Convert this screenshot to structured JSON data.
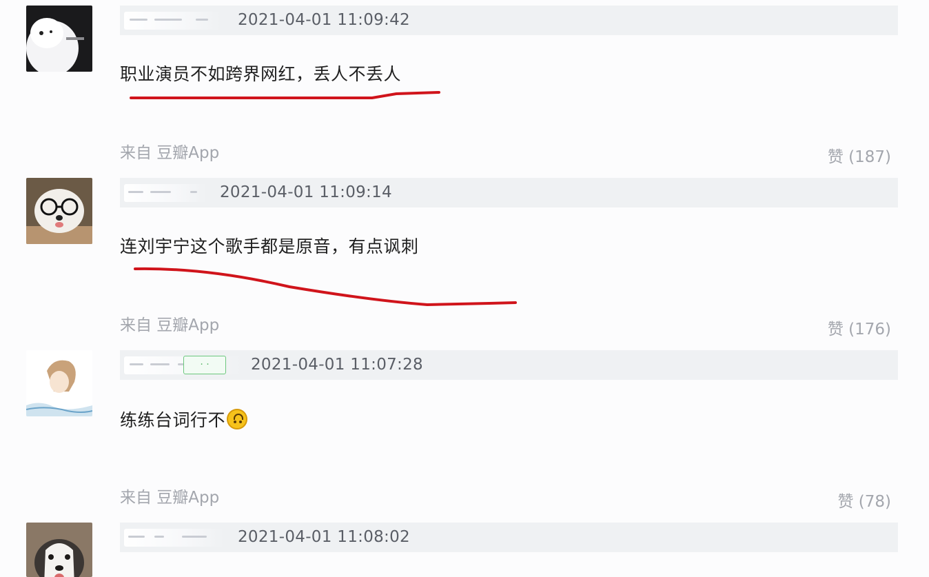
{
  "comments": [
    {
      "timestamp": "2021-04-01 11:09:42",
      "text": "职业演员不如跨界网红，丢人不丢人",
      "source": "来自 豆瓣App",
      "likes": "赞 (187)",
      "avatar_icon": "white-dog-avatar"
    },
    {
      "timestamp": "2021-04-01 11:09:14",
      "text": "连刘宇宁这个歌手都是原音，有点讽刺",
      "source": "来自 豆瓣App",
      "likes": "赞 (176)",
      "avatar_icon": "dog-with-glasses-avatar"
    },
    {
      "timestamp": "2021-04-01 11:07:28",
      "text": "练练台词行不",
      "emoji": "upside-down-face-emoji",
      "source": "来自 豆瓣App",
      "likes": "赞 (78)",
      "avatar_icon": "anime-character-avatar"
    },
    {
      "timestamp": "2021-04-01 11:08:02",
      "avatar_icon": "husky-dog-avatar"
    }
  ],
  "colors": {
    "highlight_underline": "#d0141b",
    "meta_bar": "#eff1f3",
    "secondary_text": "#a3a6ad"
  }
}
